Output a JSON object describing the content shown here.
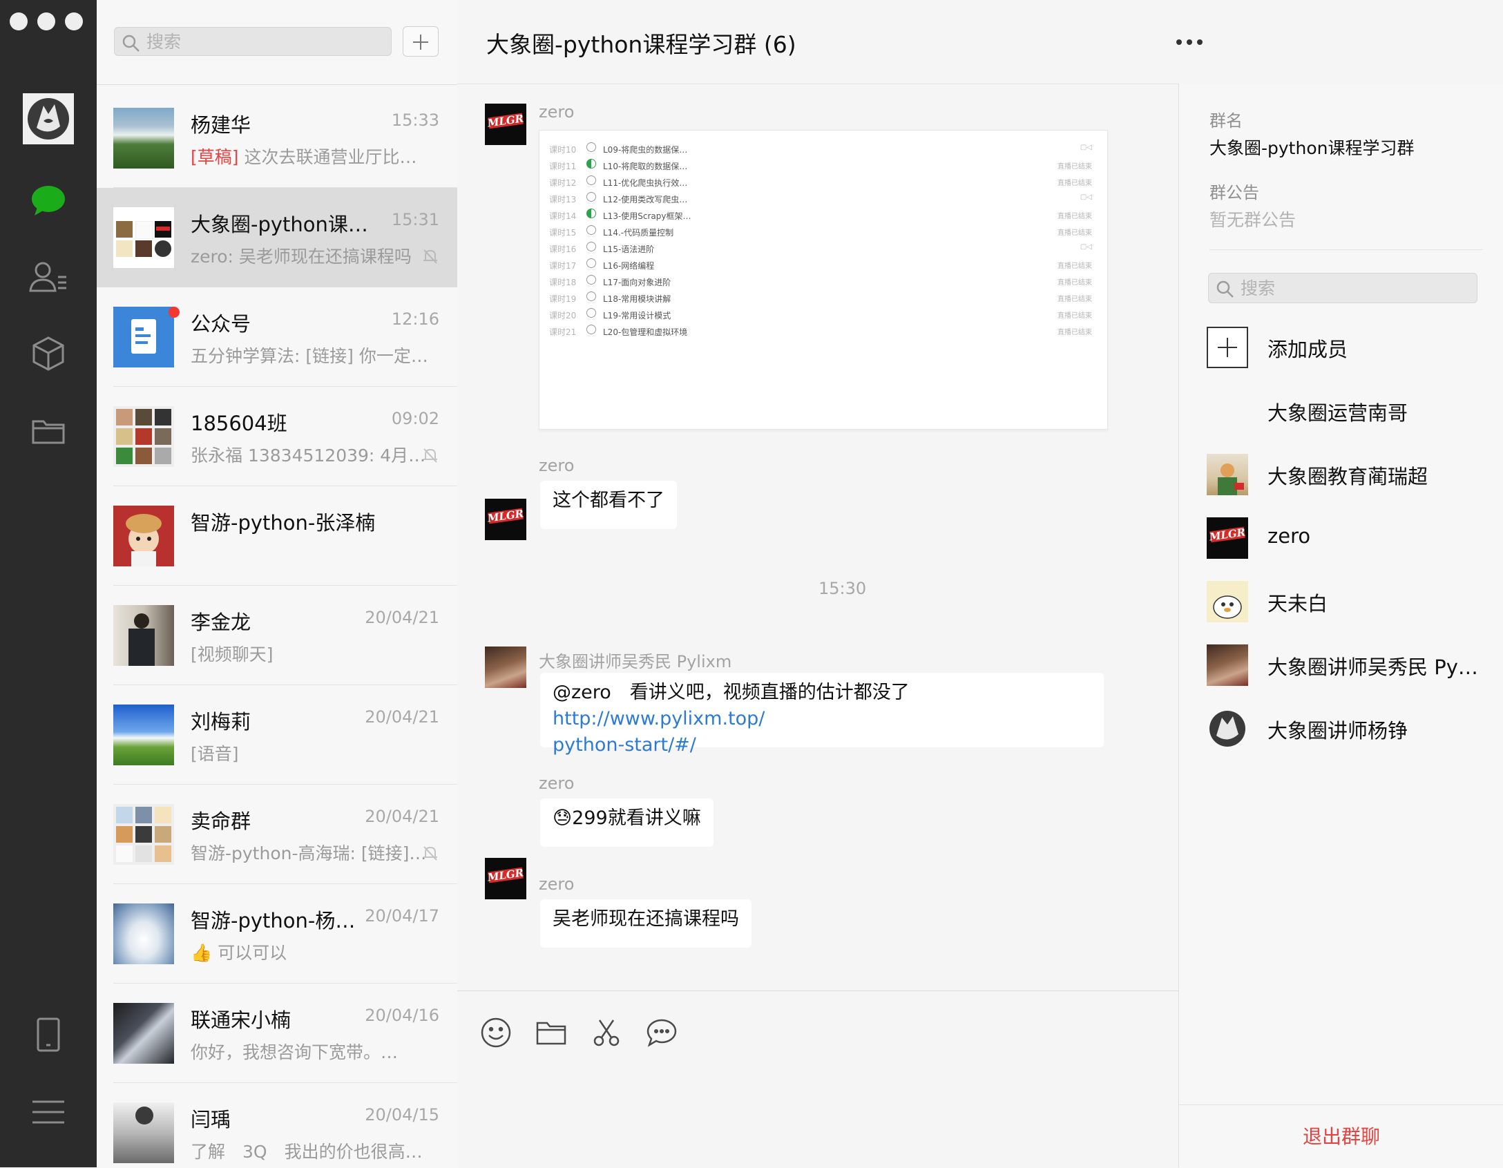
{
  "window": {
    "title": "大象圈-python课程学习群 (6)"
  },
  "search": {
    "placeholder": "搜索"
  },
  "conversations": [
    {
      "name": "杨建华",
      "time": "15:33",
      "draft_tag": "[草稿]",
      "preview": "这次去联通营业厅比较…",
      "muted": false,
      "unread": false,
      "active": false
    },
    {
      "name": "大象圈-python课程…",
      "time": "15:31",
      "draft_tag": "",
      "preview": "zero: 吴老师现在还搞课程吗",
      "muted": true,
      "unread": false,
      "active": true
    },
    {
      "name": "公众号",
      "time": "12:16",
      "draft_tag": "",
      "preview": "五分钟学算法: [链接] 你一定听…",
      "muted": false,
      "unread": true,
      "active": false
    },
    {
      "name": "185604班",
      "time": "09:02",
      "draft_tag": "",
      "preview": "张永福 13834512039: 4月…",
      "muted": true,
      "unread": false,
      "active": false
    },
    {
      "name": "智游-python-张泽楠",
      "time": "",
      "draft_tag": "",
      "preview": "",
      "muted": false,
      "unread": false,
      "active": false
    },
    {
      "name": "李金龙",
      "time": "20/04/21",
      "draft_tag": "",
      "preview": "[视频聊天]",
      "muted": false,
      "unread": false,
      "active": false
    },
    {
      "name": "刘梅莉",
      "time": "20/04/21",
      "draft_tag": "",
      "preview": "[语音]",
      "muted": false,
      "unread": false,
      "active": false
    },
    {
      "name": "卖命群",
      "time": "20/04/21",
      "draft_tag": "",
      "preview": "智游-python-高海瑞: [链接]…",
      "muted": true,
      "unread": false,
      "active": false
    },
    {
      "name": "智游-python-杨…",
      "time": "20/04/17",
      "draft_tag": "",
      "preview": "👍 可以可以",
      "muted": false,
      "unread": false,
      "active": false
    },
    {
      "name": "联通宋小楠",
      "time": "20/04/16",
      "draft_tag": "",
      "preview": "你好，我想咨询下宽带。…",
      "muted": false,
      "unread": false,
      "active": false
    },
    {
      "name": "闫瑀",
      "time": "20/04/15",
      "draft_tag": "",
      "preview": "了解　3Q　我出的价也很高…",
      "muted": false,
      "unread": false,
      "active": false
    }
  ],
  "chat": {
    "screenshot_rows": [
      {
        "k": "课时10",
        "t": "L09-将爬虫的数据保…",
        "s": "▢◁",
        "half": false
      },
      {
        "k": "课时11",
        "t": "L10-将爬取的数据保…",
        "s": "直播已结束",
        "half": true
      },
      {
        "k": "课时12",
        "t": "L11-优化爬虫执行效…",
        "s": "直播已结束",
        "half": false
      },
      {
        "k": "课时13",
        "t": "L12-使用类改写爬虫…",
        "s": "▢◁",
        "half": false
      },
      {
        "k": "课时14",
        "t": "L13-使用Scrapy框架…",
        "s": "直播已结束",
        "half": true
      },
      {
        "k": "课时15",
        "t": "L14.-代码质量控制",
        "s": "直播已结束",
        "half": false
      },
      {
        "k": "课时16",
        "t": "L15-语法进阶",
        "s": "▢◁",
        "half": false
      },
      {
        "k": "课时17",
        "t": "L16-网络编程",
        "s": "直播已结束",
        "half": false
      },
      {
        "k": "课时18",
        "t": "L17-面向对象进阶",
        "s": "直播已结束",
        "half": false
      },
      {
        "k": "课时19",
        "t": "L18-常用模块讲解",
        "s": "直播已结束",
        "half": false
      },
      {
        "k": "课时20",
        "t": "L19-常用设计模式",
        "s": "直播已结束",
        "half": false
      },
      {
        "k": "课时21",
        "t": "L20-包管理和虚拟环境",
        "s": "直播已结束",
        "half": false
      }
    ],
    "messages": [
      {
        "sender": "zero",
        "text": ""
      },
      {
        "sender": "zero",
        "text": "这个都看不了"
      },
      {
        "sender": "大象圈讲师吴秀民 Pylixm",
        "text_prefix": "@zero　看讲义吧，视频直播的估计都没了 ",
        "link": "http://www.pylixm.top/python-start/#/",
        "link_line1": "http://www.pylixm.top/",
        "link_line2": "python-start/#/"
      },
      {
        "sender": "zero",
        "emoji": "😓",
        "text": "299就看讲义嘛"
      },
      {
        "sender": "zero",
        "text": "吴老师现在还搞课程吗"
      }
    ],
    "timestamp": "15:30",
    "mlgr_logo": "MLGR"
  },
  "info": {
    "group_name_label": "群名",
    "group_name": "大象圈-python课程学习群",
    "announcement_label": "群公告",
    "announcement": "暂无群公告",
    "search_placeholder": "搜索",
    "add_member": "添加成员",
    "members": [
      {
        "name": "大象圈运营南哥"
      },
      {
        "name": "大象圈教育蔺瑞超"
      },
      {
        "name": "zero"
      },
      {
        "name": "天未白"
      },
      {
        "name": "大象圈讲师吴秀民 Pyl…"
      },
      {
        "name": "大象圈讲师杨铮"
      }
    ],
    "exit": "退出群聊"
  },
  "colors": {
    "wechat_green": "#1aad19",
    "link": "#2b7bd6",
    "danger": "#e64340",
    "rail": "#2b2b2c"
  }
}
